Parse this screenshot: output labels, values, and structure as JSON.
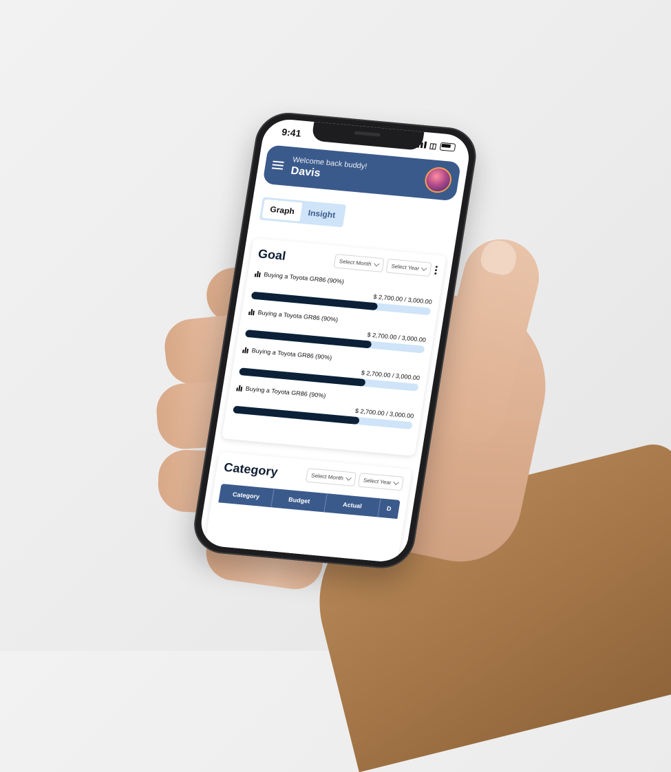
{
  "status": {
    "time": "9:41"
  },
  "header": {
    "greeting": "Welcome back buddy!",
    "name": "Davis"
  },
  "tabs": [
    {
      "label": "Graph",
      "active": true
    },
    {
      "label": "Insight",
      "active": false
    }
  ],
  "goal": {
    "title": "Goal",
    "month_placeholder": "Select Month",
    "year_placeholder": "Select Year",
    "items": [
      {
        "label": "Buying a Toyota GR86 (90%)",
        "current": "$ 2,700.00",
        "target": "3,000.00",
        "progress": 0.9
      },
      {
        "label": "Buying a Toyota GR86 (90%)",
        "current": "$ 2,700.00",
        "target": "3,000.00",
        "progress": 0.9
      },
      {
        "label": "Buying a Toyota GR86 (90%)",
        "current": "$ 2,700.00",
        "target": "3,000.00",
        "progress": 0.9
      },
      {
        "label": "Buying a Toyota GR86 (90%)",
        "current": "$ 2,700.00",
        "target": "3,000.00",
        "progress": 0.9
      }
    ]
  },
  "category": {
    "title": "Category",
    "month_placeholder": "Select Month",
    "year_placeholder": "Select Year",
    "columns": [
      "Category",
      "Budget",
      "Actual",
      "D"
    ]
  },
  "colors": {
    "header": "#3b5a8c",
    "bar_fill": "#0c2137",
    "bar_track": "#cfe4f8"
  }
}
